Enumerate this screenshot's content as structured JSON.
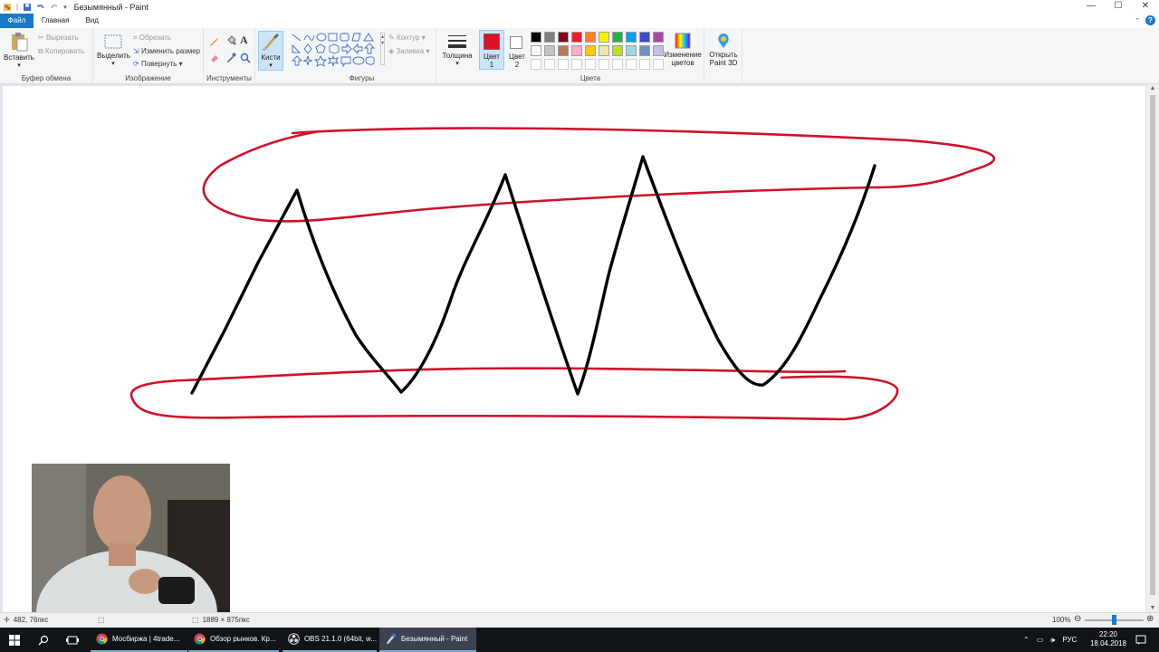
{
  "window": {
    "title": "Безымянный - Paint",
    "controls": [
      "—",
      "☐",
      "✕"
    ]
  },
  "tabs": [
    "Файл",
    "Главная",
    "Вид"
  ],
  "ribbon": {
    "clipboard": {
      "paste": "Вставить",
      "cut": "Вырезать",
      "copy": "Копировать",
      "label": "Буфер обмена"
    },
    "image": {
      "select": "Выделить",
      "crop": "Обрезать",
      "resize": "Изменить размер",
      "rotate": "Повернуть",
      "label": "Изображение"
    },
    "tools": {
      "label": "Инструменты"
    },
    "brushes": {
      "label": "Кисти"
    },
    "shapes": {
      "outline": "Контур",
      "fill": "Заливка",
      "label": "Фигуры"
    },
    "thickness": "Толщина",
    "color1": {
      "line1": "Цвет",
      "line2": "1",
      "color": "#e0102a"
    },
    "color2": {
      "line1": "Цвет",
      "line2": "2",
      "color": "#ffffff"
    },
    "colors_label": "Цвета",
    "palette_row1": [
      "#000000",
      "#7f7f7f",
      "#880015",
      "#ed1c24",
      "#ff7f27",
      "#fff200",
      "#22b14c",
      "#00a2e8",
      "#3f48cc",
      "#a349a4"
    ],
    "palette_row2": [
      "#ffffff",
      "#c3c3c3",
      "#b97a57",
      "#ffaec9",
      "#ffc90e",
      "#efe4b0",
      "#b5e61d",
      "#99d9ea",
      "#7092be",
      "#c8bfe7"
    ],
    "edit_colors": {
      "line1": "Изменение",
      "line2": "цветов"
    },
    "paint3d": {
      "line1": "Открыть",
      "line2": "Paint 3D"
    }
  },
  "status": {
    "cursor": "482, 76пкс",
    "size": "1889 × 875пкс",
    "zoom": "100%"
  },
  "taskbar": {
    "apps": [
      {
        "label": "Мосбиржа | 4trade..."
      },
      {
        "label": "Обзор рынков. Кр..."
      },
      {
        "label": "OBS 21.1.0 (64bit, w..."
      },
      {
        "label": "Безымянный - Paint"
      }
    ],
    "lang": "РУС",
    "time": "22:20",
    "date": "18.04.2018"
  }
}
